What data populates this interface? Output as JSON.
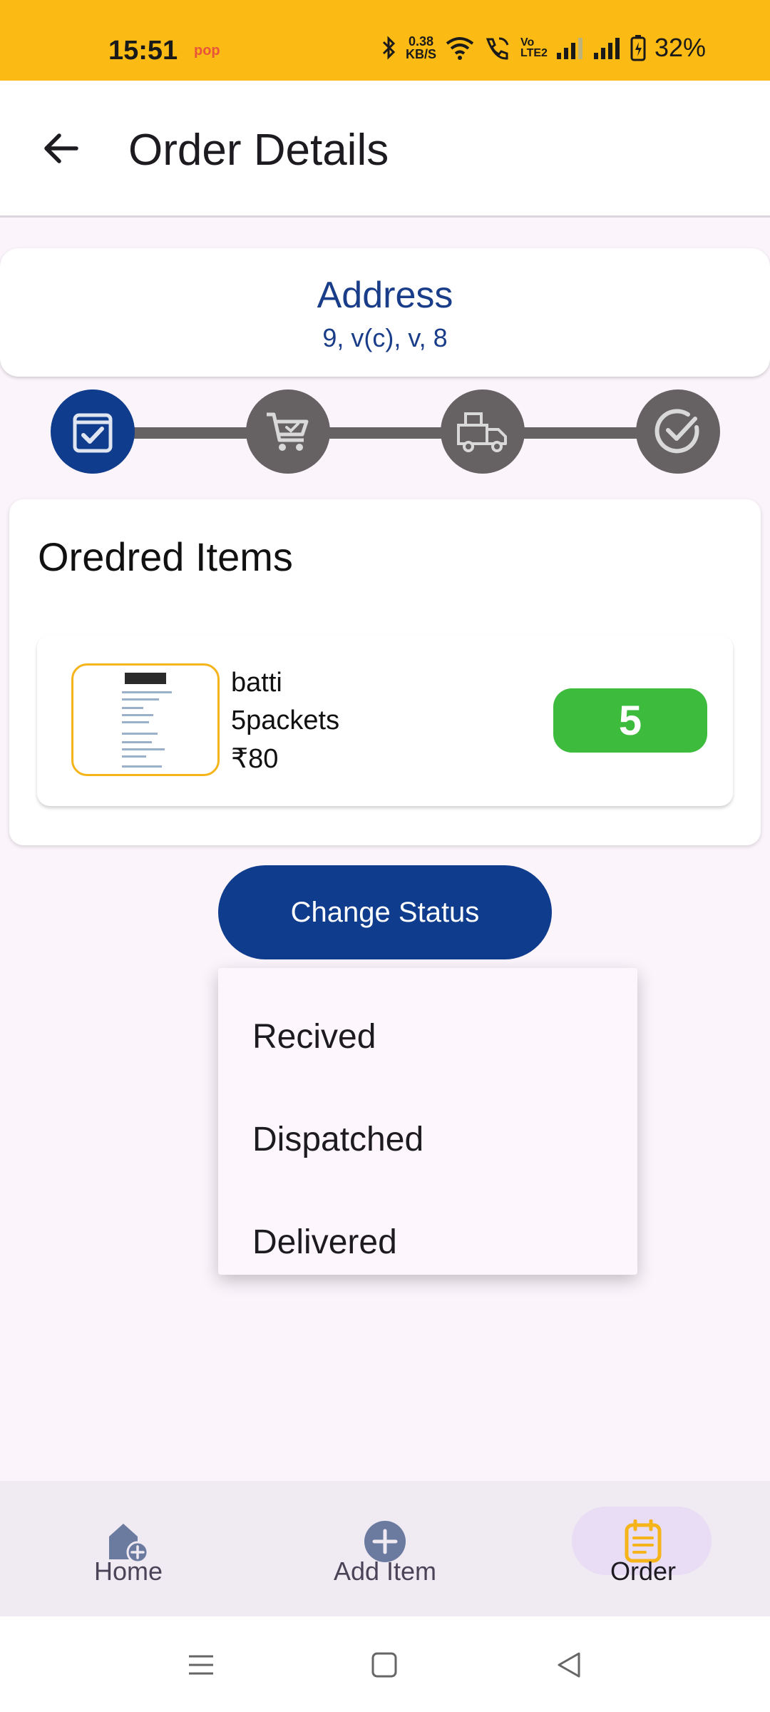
{
  "status_bar": {
    "time": "15:51",
    "app_indicator": "pop",
    "net_speed_value": "0.38",
    "net_speed_unit": "KB/S",
    "volte_line1": "Vo",
    "volte_line2": "LTE2",
    "battery": "32%"
  },
  "app_bar": {
    "title": "Order Details"
  },
  "address": {
    "title": "Address",
    "value": "9, v(c), v, 8"
  },
  "stepper": {
    "steps": [
      {
        "name": "order-placed",
        "icon": "box-check-icon",
        "active": true
      },
      {
        "name": "received",
        "icon": "cart-check-icon",
        "active": false
      },
      {
        "name": "dispatched",
        "icon": "delivery-truck-icon",
        "active": false
      },
      {
        "name": "delivered",
        "icon": "check-circle-icon",
        "active": false
      }
    ]
  },
  "items": {
    "title": "Oredred Items",
    "list": [
      {
        "name": "batti",
        "quantity_text": "5packets",
        "price": "₹80",
        "count": "5"
      }
    ]
  },
  "change_status": {
    "label": "Change Status",
    "options": [
      "Recived",
      "Dispatched",
      "Delivered"
    ]
  },
  "bottom_nav": {
    "items": [
      {
        "label": "Home",
        "icon": "home-add-icon",
        "active": false
      },
      {
        "label": "Add Item",
        "icon": "add-circle-icon",
        "active": false
      },
      {
        "label": "Order",
        "icon": "order-notepad-icon",
        "active": true
      }
    ]
  },
  "colors": {
    "status_bar": "#fcbb14",
    "primary": "#0f3c8c",
    "step_inactive": "#666264",
    "quantity_badge": "#3dbb3d",
    "thumb_border": "#f4b41a",
    "order_icon": "#f4b41a"
  }
}
